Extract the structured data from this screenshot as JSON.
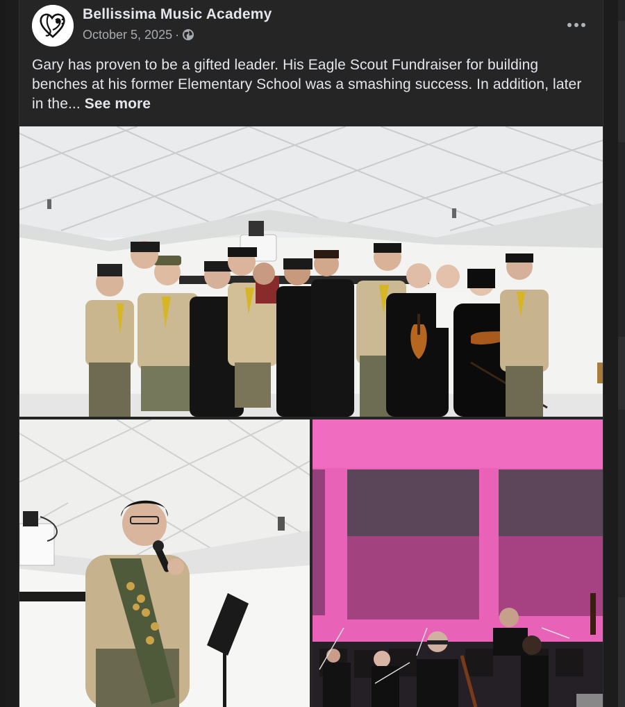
{
  "post": {
    "page_name": "Bellissima Music Academy",
    "date": "October 5, 2025",
    "separator": "·",
    "privacy_icon": "globe-icon",
    "more_icon": "more-options-icon",
    "text": "Gary has proven to be a gifted leader. His Eagle Scout Fundraiser for building benches at his former Elementary School was a smashing success. In addition, later in the...",
    "see_more_label": "See more"
  },
  "photos": [
    {
      "name": "group-photo",
      "description_icon": "photo"
    },
    {
      "name": "scout-speaking-photo",
      "description_icon": "photo"
    },
    {
      "name": "orchestra-photo",
      "description_icon": "photo"
    }
  ],
  "colors": {
    "card_background": "#252526",
    "primary_text": "#e4e6eb",
    "secondary_text": "#a8abaf",
    "stage_pink": "#e35fb3"
  }
}
